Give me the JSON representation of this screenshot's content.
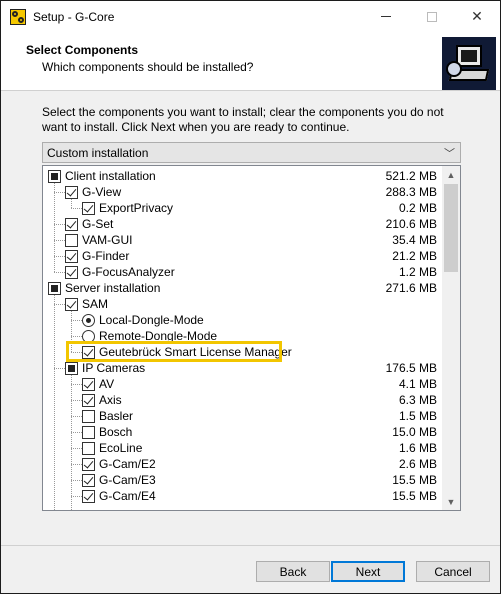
{
  "window": {
    "title": "Setup - G-Core"
  },
  "header": {
    "title": "Select Components",
    "subtitle": "Which components should be installed?"
  },
  "intro": "Select the components you want to install; clear the components you do not want to install. Click Next when you are ready to continue.",
  "install_type": {
    "selected": "Custom installation"
  },
  "components": [
    {
      "label": "Client installation",
      "size": "521.2 MB",
      "state": "partial"
    },
    {
      "label": "G-View",
      "size": "288.3 MB",
      "state": "checked"
    },
    {
      "label": "ExportPrivacy",
      "size": "0.2 MB",
      "state": "checked"
    },
    {
      "label": "G-Set",
      "size": "210.6 MB",
      "state": "checked"
    },
    {
      "label": "VAM-GUI",
      "size": "35.4 MB",
      "state": "unchecked"
    },
    {
      "label": "G-Finder",
      "size": "21.2 MB",
      "state": "checked"
    },
    {
      "label": "G-FocusAnalyzer",
      "size": "1.2 MB",
      "state": "checked"
    },
    {
      "label": "Server installation",
      "size": "271.6 MB",
      "state": "partial"
    },
    {
      "label": "SAM",
      "size": "",
      "state": "checked"
    },
    {
      "label": "Local-Dongle-Mode",
      "size": "",
      "state": "radio-selected"
    },
    {
      "label": "Remote-Dongle-Mode",
      "size": "",
      "state": "radio"
    },
    {
      "label": "Geutebrück Smart License Manager",
      "size": "",
      "state": "checked"
    },
    {
      "label": "IP Cameras",
      "size": "176.5 MB",
      "state": "partial"
    },
    {
      "label": "AV",
      "size": "4.1 MB",
      "state": "checked"
    },
    {
      "label": "Axis",
      "size": "6.3 MB",
      "state": "checked"
    },
    {
      "label": "Basler",
      "size": "1.5 MB",
      "state": "unchecked"
    },
    {
      "label": "Bosch",
      "size": "15.0 MB",
      "state": "unchecked"
    },
    {
      "label": "EcoLine",
      "size": "1.6 MB",
      "state": "unchecked"
    },
    {
      "label": "G-Cam/E2",
      "size": "2.6 MB",
      "state": "checked"
    },
    {
      "label": "G-Cam/E3",
      "size": "15.5 MB",
      "state": "checked"
    },
    {
      "label": "G-Cam/E4",
      "size": "15.5 MB",
      "state": "checked"
    }
  ],
  "buttons": {
    "back": "Back",
    "next": "Next",
    "cancel": "Cancel"
  },
  "colors": {
    "highlight": "#f2c600",
    "accent": "#0078d7"
  }
}
